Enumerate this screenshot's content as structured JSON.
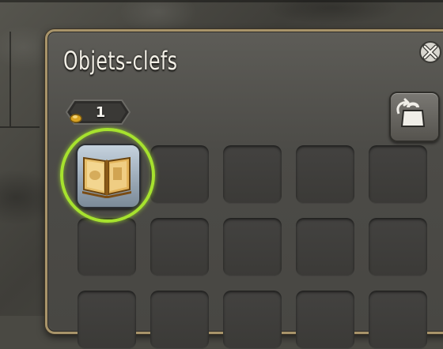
{
  "window": {
    "title": "Objets-clefs",
    "close_icon": "close-icon"
  },
  "inventory": {
    "item_count": "1",
    "selected_item_icon": "open-book-icon",
    "sort_icon": "sort-bag-icon",
    "highlight_color": "#a6e22e"
  }
}
